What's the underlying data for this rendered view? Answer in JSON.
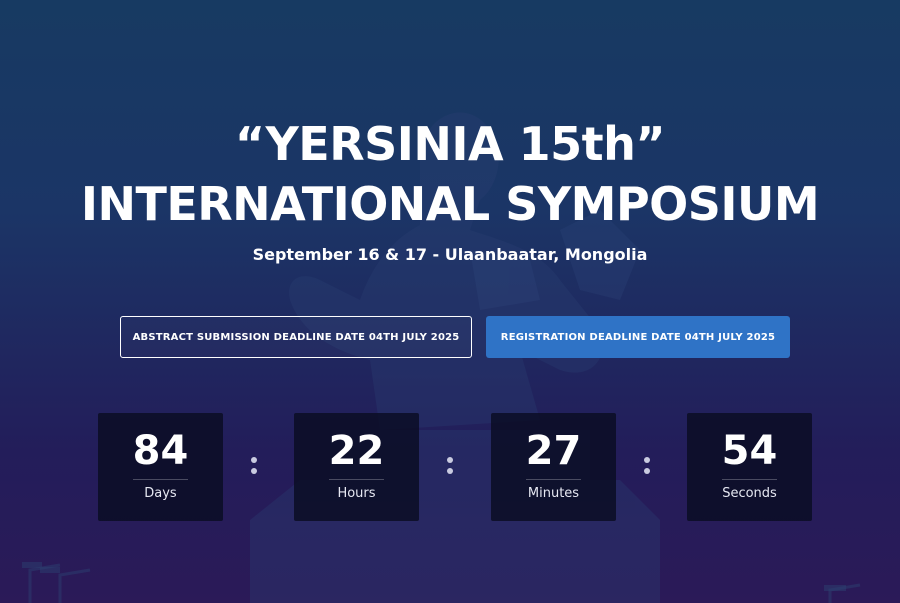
{
  "hero": {
    "title_line1": "“YERSINIA 15th”",
    "title_line2": "INTERNATIONAL SYMPOSIUM",
    "subtitle": "September 16 & 17 - Ulaanbaatar, Mongolia"
  },
  "buttons": {
    "abstract_label": "ABSTRACT SUBMISSION DEADLINE DATE 04TH JULY 2025",
    "registration_label": "REGISTRATION DEADLINE DATE 04TH JULY 2025"
  },
  "countdown": [
    {
      "value": "84",
      "label": "Days"
    },
    {
      "value": "22",
      "label": "Hours"
    },
    {
      "value": "27",
      "label": "Minutes"
    },
    {
      "value": "54",
      "label": "Seconds"
    }
  ],
  "colors": {
    "background_top": "#173a62",
    "background_bottom": "#2b1a58",
    "accent_button": "#2f73c6",
    "counter_box": "#0a0c22",
    "text": "#ffffff"
  }
}
